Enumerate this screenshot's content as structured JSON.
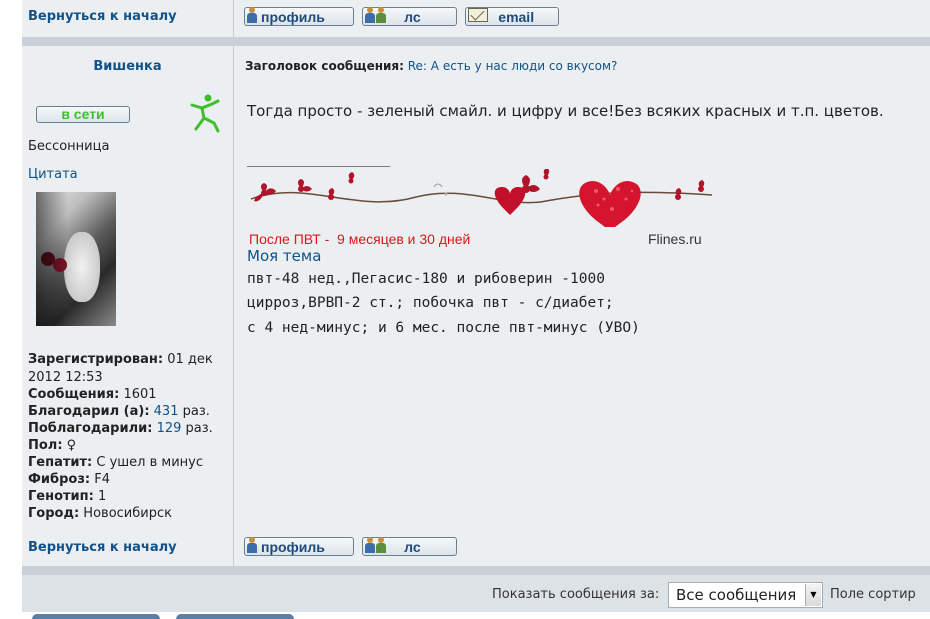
{
  "top_row": {
    "back_link": "Вернуться к началу",
    "buttons": {
      "profile": "профиль",
      "pm": "лс",
      "email": "email"
    }
  },
  "post": {
    "author": "Вишенка",
    "subject_label": "Заголовок сообщения:",
    "subject_value": "Re: А есть у нас люди со вкусом?",
    "online_label": "в сети",
    "rank": "Бессонница",
    "quote_link": "Цитата",
    "body_text": "Тогда просто - зеленый смайл. и цифру и все!Без всяких красных и т.п. цветов.",
    "signature_separator": "_________________",
    "banner": {
      "caption": "После ПВТ -  9 месяцев и 30 дней",
      "site": "Flines.ru"
    },
    "signature_link": "Моя тема",
    "signature_lines": [
      "пвт-48 нед.,Пегасис-180 и рибоверин -1000",
      "цирроз,ВРВП-2 ст.; побочка пвт - с/диабет;",
      "с 4 нед-минус; и 6 мес. после пвт-минус (УВО)"
    ],
    "profile": {
      "registered_label": "Зарегистрирован:",
      "registered_value_1": "01 дек",
      "registered_value_2": "2012 12:53",
      "messages_label": "Сообщения:",
      "messages_value": "1601",
      "thanked_label": "Благодарил (а):",
      "thanked_value": "431",
      "thanked_suffix": "раз.",
      "got_thanks_label": "Поблагодарили:",
      "got_thanks_value": "129",
      "got_thanks_suffix": "раз.",
      "gender_label": "Пол:",
      "gender_value": "♀",
      "hepatitis_label": "Гепатит:",
      "hepatitis_value": "С ушел в минус",
      "fibrosis_label": "Фиброз:",
      "fibrosis_value": "F4",
      "genotype_label": "Генотип:",
      "genotype_value": "1",
      "city_label": "Город:",
      "city_value": "Новосибирск"
    }
  },
  "bottom_row": {
    "back_link": "Вернуться к началу",
    "buttons": {
      "profile": "профиль",
      "pm": "лс"
    }
  },
  "footer": {
    "show_label": "Показать сообщения за:",
    "select_value": "Все сообщения",
    "sort_label": "Поле сортир"
  },
  "colors": {
    "link": "#105289",
    "online_green": "#3fbf2a",
    "banner_red": "#d41a1a"
  }
}
